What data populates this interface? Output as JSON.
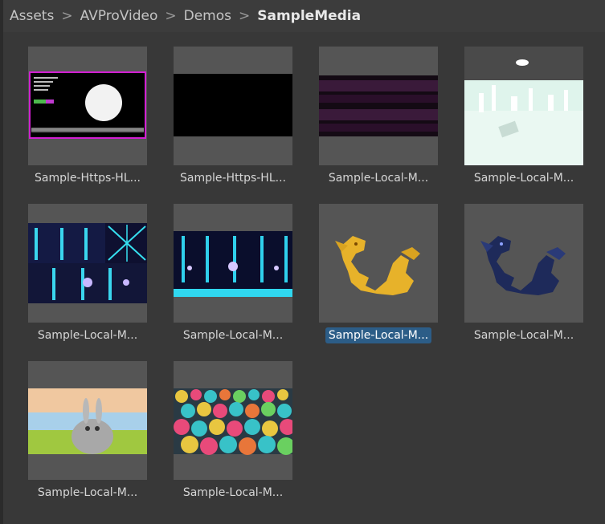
{
  "breadcrumb": {
    "items": [
      "Assets",
      "AVProVideo",
      "Demos",
      "SampleMedia"
    ],
    "separator": ">"
  },
  "assets": [
    {
      "label": "Sample-Https-HL..."
    },
    {
      "label": "Sample-Https-HL..."
    },
    {
      "label": "Sample-Local-M..."
    },
    {
      "label": "Sample-Local-M..."
    },
    {
      "label": "Sample-Local-M..."
    },
    {
      "label": "Sample-Local-M..."
    },
    {
      "label": "Sample-Local-M...",
      "selected": true
    },
    {
      "label": "Sample-Local-M..."
    },
    {
      "label": "Sample-Local-M..."
    },
    {
      "label": "Sample-Local-M..."
    }
  ],
  "colors": {
    "background": "#383838",
    "thumb_bg": "#555555",
    "selection": "#2c5d87",
    "text": "#d6d6d6"
  }
}
